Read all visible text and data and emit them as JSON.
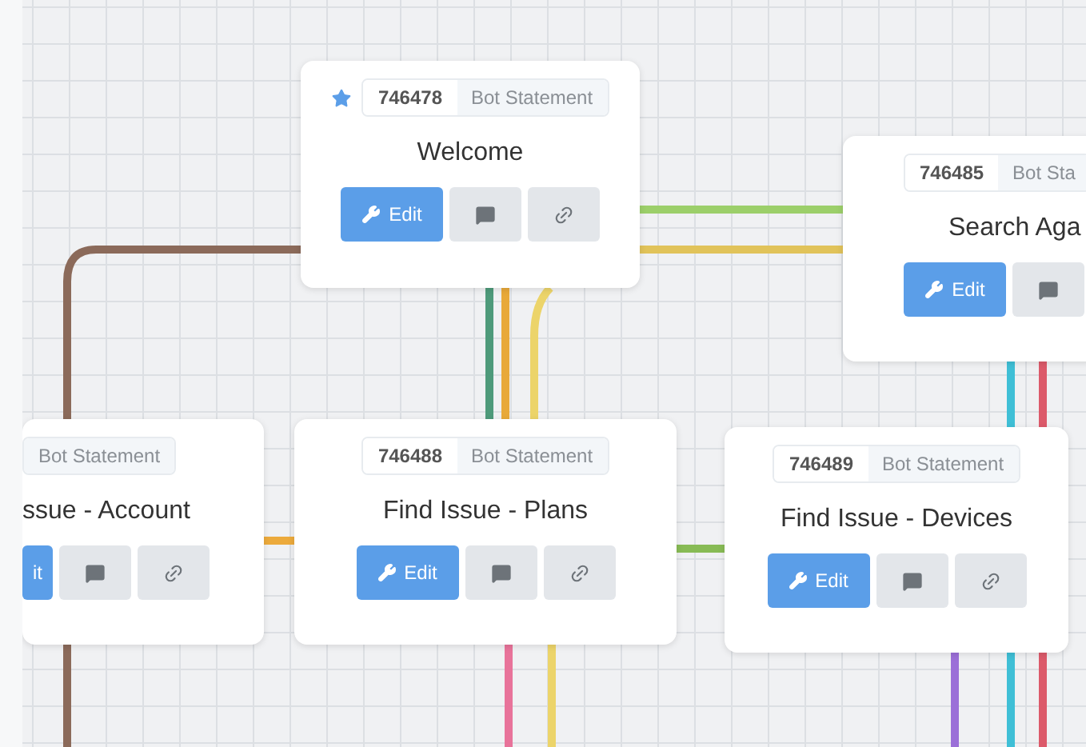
{
  "nodes": [
    {
      "starred": true,
      "id_badge": "746478",
      "type_label": "Bot Statement",
      "title": "Welcome",
      "buttons": [
        {
          "kind": "edit",
          "label": "Edit"
        },
        {
          "kind": "comment"
        },
        {
          "kind": "link"
        }
      ]
    },
    {
      "starred": false,
      "id_badge": "746485",
      "type_label": "Bot Sta",
      "title": "Search Aga",
      "buttons": [
        {
          "kind": "edit",
          "label": "Edit"
        },
        {
          "kind": "comment"
        }
      ]
    },
    {
      "starred": false,
      "type_label": "Bot Statement",
      "title": "ssue - Account",
      "buttons": [
        {
          "kind": "edit",
          "label": "it"
        },
        {
          "kind": "comment"
        },
        {
          "kind": "link"
        }
      ]
    },
    {
      "starred": false,
      "id_badge": "746488",
      "type_label": "Bot Statement",
      "title": "Find Issue - Plans",
      "buttons": [
        {
          "kind": "edit",
          "label": "Edit"
        },
        {
          "kind": "comment"
        },
        {
          "kind": "link"
        }
      ]
    },
    {
      "starred": false,
      "id_badge": "746489",
      "type_label": "Bot Statement",
      "title": "Find Issue - Devices",
      "buttons": [
        {
          "kind": "edit",
          "label": "Edit"
        },
        {
          "kind": "comment"
        },
        {
          "kind": "link"
        }
      ]
    }
  ]
}
